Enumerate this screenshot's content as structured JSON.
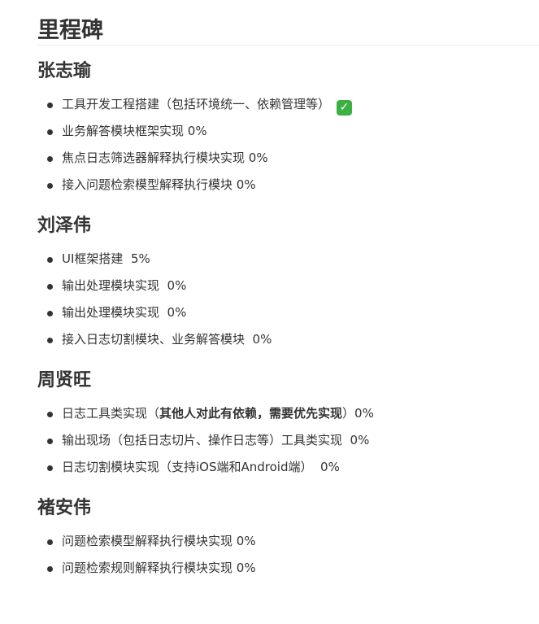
{
  "title": "里程碑",
  "sections": [
    {
      "name": "张志瑜",
      "items": [
        {
          "text": "工具开发工程搭建（包括环境统一、依赖管理等）",
          "check": "✓"
        },
        {
          "text": "业务解答模块框架实现 0%"
        },
        {
          "text": "焦点日志筛选器解释执行模块实现 0%"
        },
        {
          "text": "接入问题检索模型解释执行模块 0%"
        }
      ]
    },
    {
      "name": "刘泽伟",
      "items": [
        {
          "text": "UI框架搭建  5%"
        },
        {
          "text": "输出处理模块实现  0%"
        },
        {
          "text": "输出处理模块实现  0%"
        },
        {
          "text": "接入日志切割模块、业务解答模块  0%"
        }
      ]
    },
    {
      "name": "周贤旺",
      "items": [
        {
          "pre": "日志工具类实现（",
          "bold": "其他人对此有依赖，需要优先实现",
          "post": "）0%"
        },
        {
          "text": "输出现场（包括日志切片、操作日志等）工具类实现  0%"
        },
        {
          "text": "日志切割模块实现（支持iOS端和Android端）  0%"
        }
      ]
    },
    {
      "name": "褚安伟",
      "items": [
        {
          "text": "问题检索模型解释执行模块实现 0%"
        },
        {
          "text": "问题检索规则解释执行模块实现 0%"
        }
      ]
    }
  ],
  "colors": {
    "text": "#333333",
    "check_bg": "#3cb043"
  },
  "icons": {
    "done": "check-mark-icon"
  }
}
